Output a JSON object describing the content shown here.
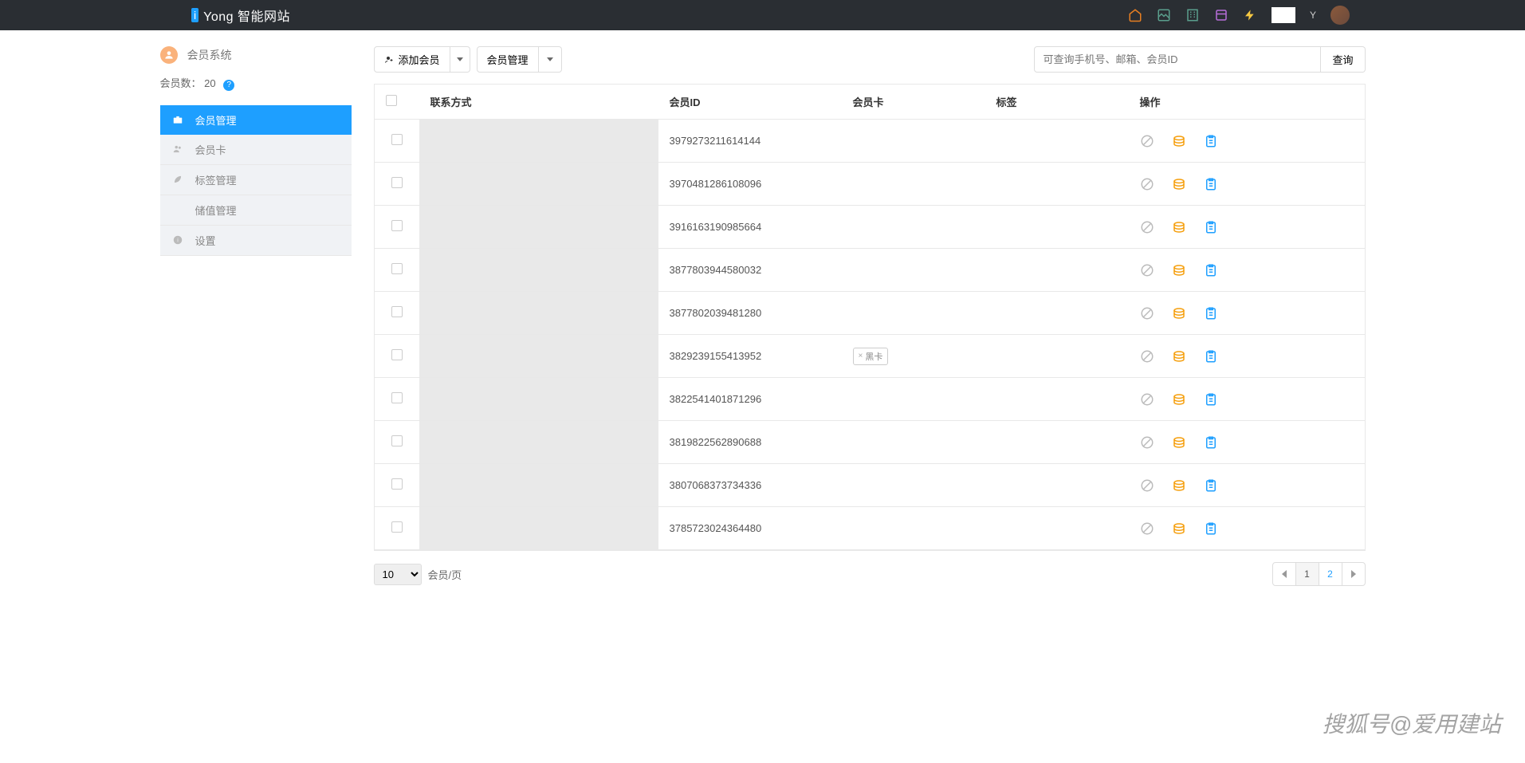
{
  "topnav": {
    "logo_badge": "i",
    "logo_text": "Yong 智能网站"
  },
  "sidebar": {
    "title": "会员系统",
    "count_label": "会员数：",
    "count_value": "20",
    "items": [
      {
        "label": "会员管理",
        "icon": "briefcase"
      },
      {
        "label": "会员卡",
        "icon": "users"
      },
      {
        "label": "标签管理",
        "icon": "leaf"
      },
      {
        "label": "储值管理",
        "icon": "download"
      },
      {
        "label": "设置",
        "icon": "info"
      }
    ]
  },
  "toolbar": {
    "add_label": "添加会员",
    "manage_label": "会员管理",
    "search_placeholder": "可查询手机号、邮箱、会员ID",
    "search_btn": "查询"
  },
  "table": {
    "headers": {
      "contact": "联系方式",
      "member_id": "会员ID",
      "card": "会员卡",
      "tag": "标签",
      "ops": "操作"
    },
    "rows": [
      {
        "id": "3979273211614144",
        "card": "",
        "tag": ""
      },
      {
        "id": "3970481286108096",
        "card": "",
        "tag": ""
      },
      {
        "id": "3916163190985664",
        "card": "",
        "tag": ""
      },
      {
        "id": "3877803944580032",
        "card": "",
        "tag": ""
      },
      {
        "id": "3877802039481280",
        "card": "",
        "tag": ""
      },
      {
        "id": "3829239155413952",
        "card": "黑卡",
        "tag": ""
      },
      {
        "id": "3822541401871296",
        "card": "",
        "tag": ""
      },
      {
        "id": "3819822562890688",
        "card": "",
        "tag": ""
      },
      {
        "id": "3807068373734336",
        "card": "",
        "tag": ""
      },
      {
        "id": "3785723024364480",
        "card": "",
        "tag": ""
      }
    ]
  },
  "footer": {
    "per_page_val": "10",
    "per_page_label": "会员/页",
    "pages": [
      "1",
      "2"
    ],
    "active_page": "1"
  },
  "watermark": "搜狐号@爱用建站",
  "colors": {
    "primary": "#1e9fff",
    "orange": "#f59e0b"
  }
}
